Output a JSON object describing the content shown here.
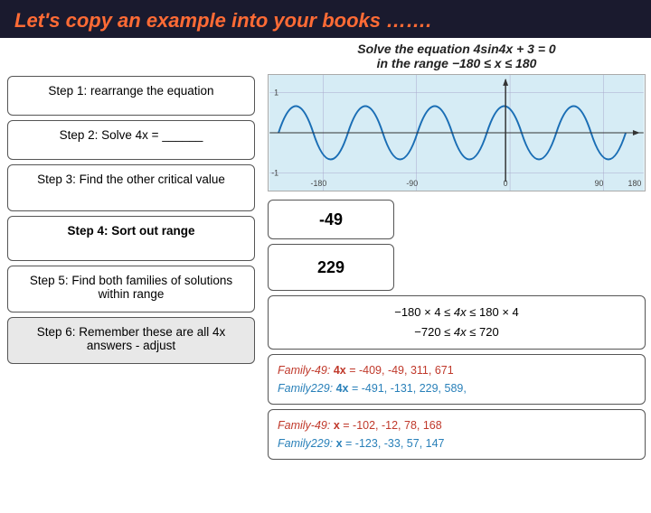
{
  "header": {
    "title": "Let's copy an example into your books ……."
  },
  "subtitle": {
    "line1": "Solve the equation 4sin4x + 3 = 0",
    "line2": "in the range −180 ≤ x ≤ 180"
  },
  "steps": [
    {
      "id": "step1",
      "label": "Step 1: rearrange the equation"
    },
    {
      "id": "step2",
      "label": "Step 2: Solve 4x = ______"
    },
    {
      "id": "step3",
      "label": "Step 3: Find the other critical value"
    },
    {
      "id": "step4",
      "label": "Step 4: Sort out range"
    },
    {
      "id": "step5",
      "label": "Step 5: Find both families of solutions within range"
    },
    {
      "id": "step6",
      "label": "Step 6: Remember these are all 4x answers - adjust"
    }
  ],
  "answers": {
    "step2_answer": "-49",
    "step3_answer": "229",
    "range_line1": "−180 × 4 ≤ 4x ≤ 180 × 4",
    "range_line2": "−720 ≤ 4x ≤ 720",
    "family49_step5": "Family-49:  4x = -409, -49, 311, 671",
    "family229_step5": "Family229:  4x = -491, -131, 229, 589,",
    "family49_step6": "Family-49:  x = -102, -12, 78, 168",
    "family229_step6": "Family229:  x = -123, -33, 57, 147"
  },
  "graph": {
    "axis_labels": [
      "-180",
      "-90",
      "0",
      "90",
      "180"
    ],
    "y_labels": [
      "1",
      "-1"
    ]
  }
}
